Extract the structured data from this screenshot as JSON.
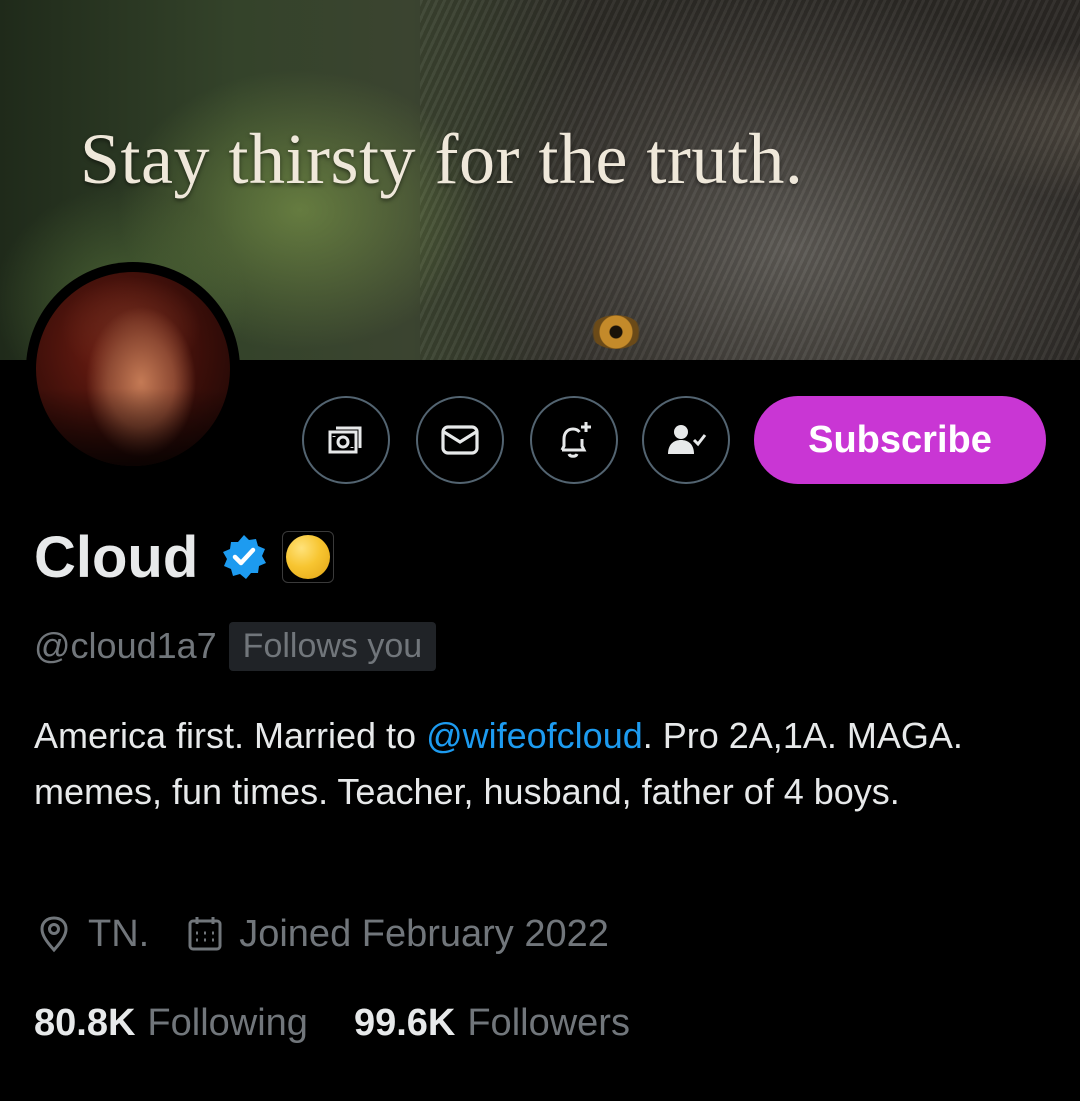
{
  "banner": {
    "tagline": "Stay thirsty for the truth."
  },
  "actions": {
    "tip_icon": "money-icon",
    "message_icon": "envelope-icon",
    "notify_icon": "bell-plus-icon",
    "following_icon": "person-check-icon",
    "subscribe_label": "Subscribe"
  },
  "profile": {
    "name": "Cloud",
    "handle": "@cloud1a7",
    "follows_you": "Follows you",
    "bio_before": "America first. Married to ",
    "bio_mention": "@wifeofcloud",
    "bio_after": ". Pro 2A,1A. MAGA.  memes, fun times. Teacher, husband, father of 4 boys.",
    "location": "TN.",
    "joined": "Joined February 2022",
    "following_count": "80.8K",
    "following_label": "Following",
    "followers_count": "99.6K",
    "followers_label": "Followers"
  },
  "colors": {
    "background": "#000000",
    "text_primary": "#e7e9ea",
    "text_secondary": "#71767b",
    "link": "#1d9bf0",
    "subscribe": "#c936d4",
    "verified": "#1d9bf0"
  }
}
